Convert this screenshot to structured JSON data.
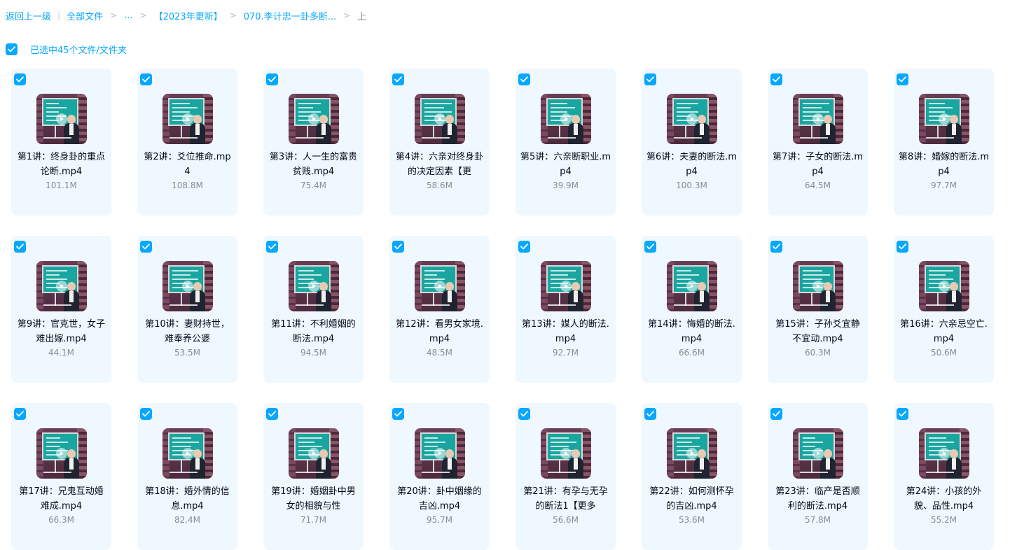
{
  "breadcrumb": {
    "back": "返回上一级",
    "sep_bar": "|",
    "items": [
      "全部文件",
      "...",
      "【2023年更新】",
      "070.李计忠一卦多断...",
      "上"
    ],
    "sep": ">"
  },
  "selection": {
    "label": "已选中45个文件/文件夹",
    "checked": true
  },
  "colors": {
    "accent": "#06a7ff",
    "card_bg": "#eef8fe",
    "text": "#03081a",
    "muted": "#878c9c"
  },
  "files": [
    {
      "name": "第1讲：终身卦的重点论断.mp4",
      "size": "101.1M"
    },
    {
      "name": "第2讲：爻位推命.mp4",
      "size": "108.8M"
    },
    {
      "name": "第3讲：人一生的富贵贫贱.mp4",
      "size": "75.4M"
    },
    {
      "name": "第4讲：六亲对终身卦的决定因素【更",
      "size": "58.6M"
    },
    {
      "name": "第5讲：六亲断职业.mp4",
      "size": "39.9M"
    },
    {
      "name": "第6讲：夫妻的断法.mp4",
      "size": "100.3M"
    },
    {
      "name": "第7讲：子女的断法.mp4",
      "size": "64.5M"
    },
    {
      "name": "第8讲：婚嫁的断法.mp4",
      "size": "97.7M"
    },
    {
      "name": "第9讲：官克世，女子难出嫁.mp4",
      "size": "44.1M"
    },
    {
      "name": "第10讲：妻财持世，难奉养公婆",
      "size": "53.5M"
    },
    {
      "name": "第11讲：不利婚姻的断法.mp4",
      "size": "94.5M"
    },
    {
      "name": "第12讲：看男女家境.mp4",
      "size": "48.5M"
    },
    {
      "name": "第13讲：媒人的断法.mp4",
      "size": "92.7M"
    },
    {
      "name": "第14讲：悔婚的断法.mp4",
      "size": "66.6M"
    },
    {
      "name": "第15讲：子孙爻宜静不宜动.mp4",
      "size": "60.3M"
    },
    {
      "name": "第16讲：六亲忌空亡.mp4",
      "size": "50.6M"
    },
    {
      "name": "第17讲：兄鬼互动婚难成.mp4",
      "size": "66.3M"
    },
    {
      "name": "第18讲：婚外情的信息.mp4",
      "size": "82.4M"
    },
    {
      "name": "第19讲：婚姻卦中男女的相貌与性",
      "size": "71.7M"
    },
    {
      "name": "第20讲：卦中姻缘的吉凶.mp4",
      "size": "95.7M"
    },
    {
      "name": "第21讲：有孕与无孕的断法1【更多",
      "size": "56.6M"
    },
    {
      "name": "第22讲：如何测怀孕的吉凶.mp4",
      "size": "53.6M"
    },
    {
      "name": "第23讲：临产是否顺利的断法.mp4",
      "size": "57.8M"
    },
    {
      "name": "第24讲：小孩的外貌、品性.mp4",
      "size": "55.2M"
    }
  ]
}
